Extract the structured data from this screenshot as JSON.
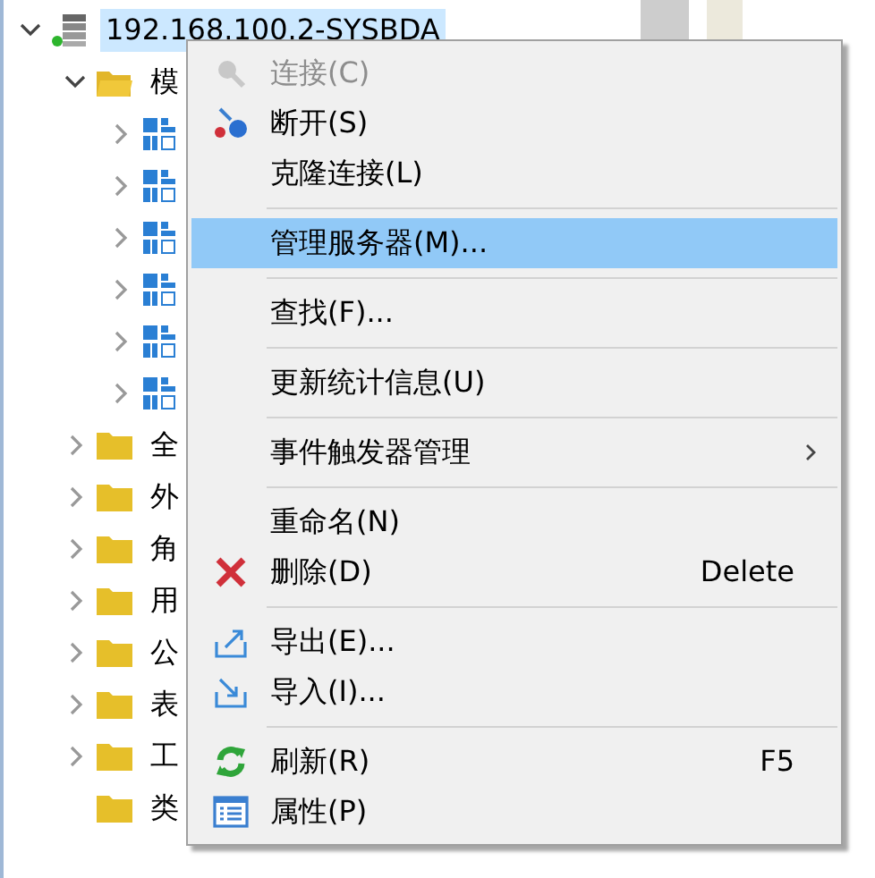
{
  "tree": [
    {
      "label": "192.168.100.2-SYSBDA",
      "kind": "server",
      "expanded": true,
      "has_children": true,
      "selected": true,
      "children": [
        {
          "label": "模",
          "kind": "folder",
          "expanded": true,
          "has_children": true,
          "selected": false,
          "children": [
            {
              "kind": "schema",
              "expanded": false,
              "has_children": true,
              "selected": false
            },
            {
              "kind": "schema",
              "expanded": false,
              "has_children": true,
              "selected": false
            },
            {
              "kind": "schema",
              "expanded": false,
              "has_children": true,
              "selected": false
            },
            {
              "kind": "schema",
              "expanded": false,
              "has_children": true,
              "selected": false
            },
            {
              "kind": "schema",
              "expanded": false,
              "has_children": true,
              "selected": false
            },
            {
              "kind": "schema",
              "expanded": false,
              "has_children": true,
              "selected": false
            }
          ]
        },
        {
          "label": "全",
          "kind": "folder",
          "expanded": false,
          "has_children": true,
          "selected": false
        },
        {
          "label": "外",
          "kind": "folder",
          "expanded": false,
          "has_children": true,
          "selected": false
        },
        {
          "label": "角",
          "kind": "folder",
          "expanded": false,
          "has_children": true,
          "selected": false
        },
        {
          "label": "用",
          "kind": "folder",
          "expanded": false,
          "has_children": true,
          "selected": false
        },
        {
          "label": "公",
          "kind": "folder",
          "expanded": false,
          "has_children": true,
          "selected": false
        },
        {
          "label": "表",
          "kind": "folder",
          "expanded": false,
          "has_children": true,
          "selected": false
        },
        {
          "label": "工",
          "kind": "folder",
          "expanded": false,
          "has_children": true,
          "selected": false
        },
        {
          "label": "类",
          "kind": "folder",
          "expanded": false,
          "has_children": false,
          "selected": false
        }
      ]
    }
  ],
  "context_menu": [
    {
      "kind": "connect",
      "label": "连接(C)",
      "disabled": true,
      "selected": false
    },
    {
      "kind": "disconnect",
      "label": "断开(S)",
      "disabled": false,
      "selected": false
    },
    {
      "kind": "plain",
      "label": "克隆连接(L)",
      "disabled": false,
      "selected": false
    },
    {
      "kind": "separator"
    },
    {
      "kind": "plain",
      "label": "管理服务器(M)...",
      "disabled": false,
      "selected": true
    },
    {
      "kind": "separator"
    },
    {
      "kind": "plain",
      "label": "查找(F)...",
      "disabled": false,
      "selected": false
    },
    {
      "kind": "separator"
    },
    {
      "kind": "plain",
      "label": "更新统计信息(U)",
      "disabled": false,
      "selected": false
    },
    {
      "kind": "separator"
    },
    {
      "kind": "submenu",
      "label": "事件触发器管理",
      "disabled": false,
      "selected": false
    },
    {
      "kind": "separator"
    },
    {
      "kind": "plain",
      "label": "重命名(N)",
      "disabled": false,
      "selected": false
    },
    {
      "kind": "delete",
      "label": "删除(D)",
      "shortcut": "Delete",
      "disabled": false,
      "selected": false
    },
    {
      "kind": "separator"
    },
    {
      "kind": "export",
      "label": "导出(E)...",
      "disabled": false,
      "selected": false
    },
    {
      "kind": "import",
      "label": "导入(I)...",
      "disabled": false,
      "selected": false
    },
    {
      "kind": "separator"
    },
    {
      "kind": "refresh",
      "label": "刷新(R)",
      "shortcut": "F5",
      "disabled": false,
      "selected": false
    },
    {
      "kind": "properties",
      "label": "属性(P)",
      "disabled": false,
      "selected": false
    }
  ]
}
